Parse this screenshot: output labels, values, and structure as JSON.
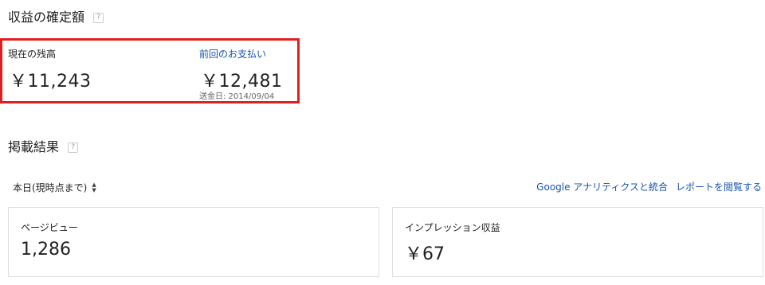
{
  "earnings": {
    "title": "収益の確定額",
    "help_icon": "?",
    "current_balance": {
      "label": "現在の残高",
      "value": "￥11,243"
    },
    "last_payment": {
      "label": "前回のお支払い",
      "value": "￥12,481",
      "date_label": "送金日: 2014/09/04"
    },
    "highlight_color": "#e02020"
  },
  "performance": {
    "title": "掲載結果",
    "help_icon": "?",
    "range_selector": "本日(現時点まで)",
    "links": {
      "analytics": "Google アナリティクスと統合",
      "view_report": "レポートを閲覧する"
    },
    "cards": [
      {
        "label": "ページビュー",
        "value": "1,286"
      },
      {
        "label": "インプレッション収益",
        "value": "￥67"
      }
    ],
    "link_color": "#1a55b0"
  }
}
